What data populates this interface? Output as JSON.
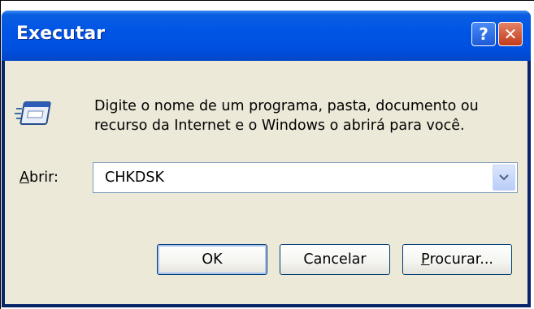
{
  "window": {
    "title": "Executar",
    "help_glyph": "?",
    "close_glyph": "✕"
  },
  "description": {
    "line1": "Digite o nome de um programa, pasta, documento ou",
    "line2": "recurso da Internet e o Windows o abrirá para você."
  },
  "open_field": {
    "label_mnemonic": "A",
    "label_rest": "brir:",
    "value": "CHKDSK"
  },
  "buttons": {
    "ok": "OK",
    "cancel": "Cancelar",
    "browse_mnemonic": "P",
    "browse_rest": "rocurar..."
  },
  "icons": {
    "run": "run-dialog-icon",
    "help": "help-icon",
    "close": "close-icon",
    "dropdown": "chevron-down-icon"
  },
  "colors": {
    "titlebar": "#0055e5",
    "client_bg": "#ece9d8",
    "close_button": "#c23b1a",
    "field_border": "#7f9db9"
  }
}
